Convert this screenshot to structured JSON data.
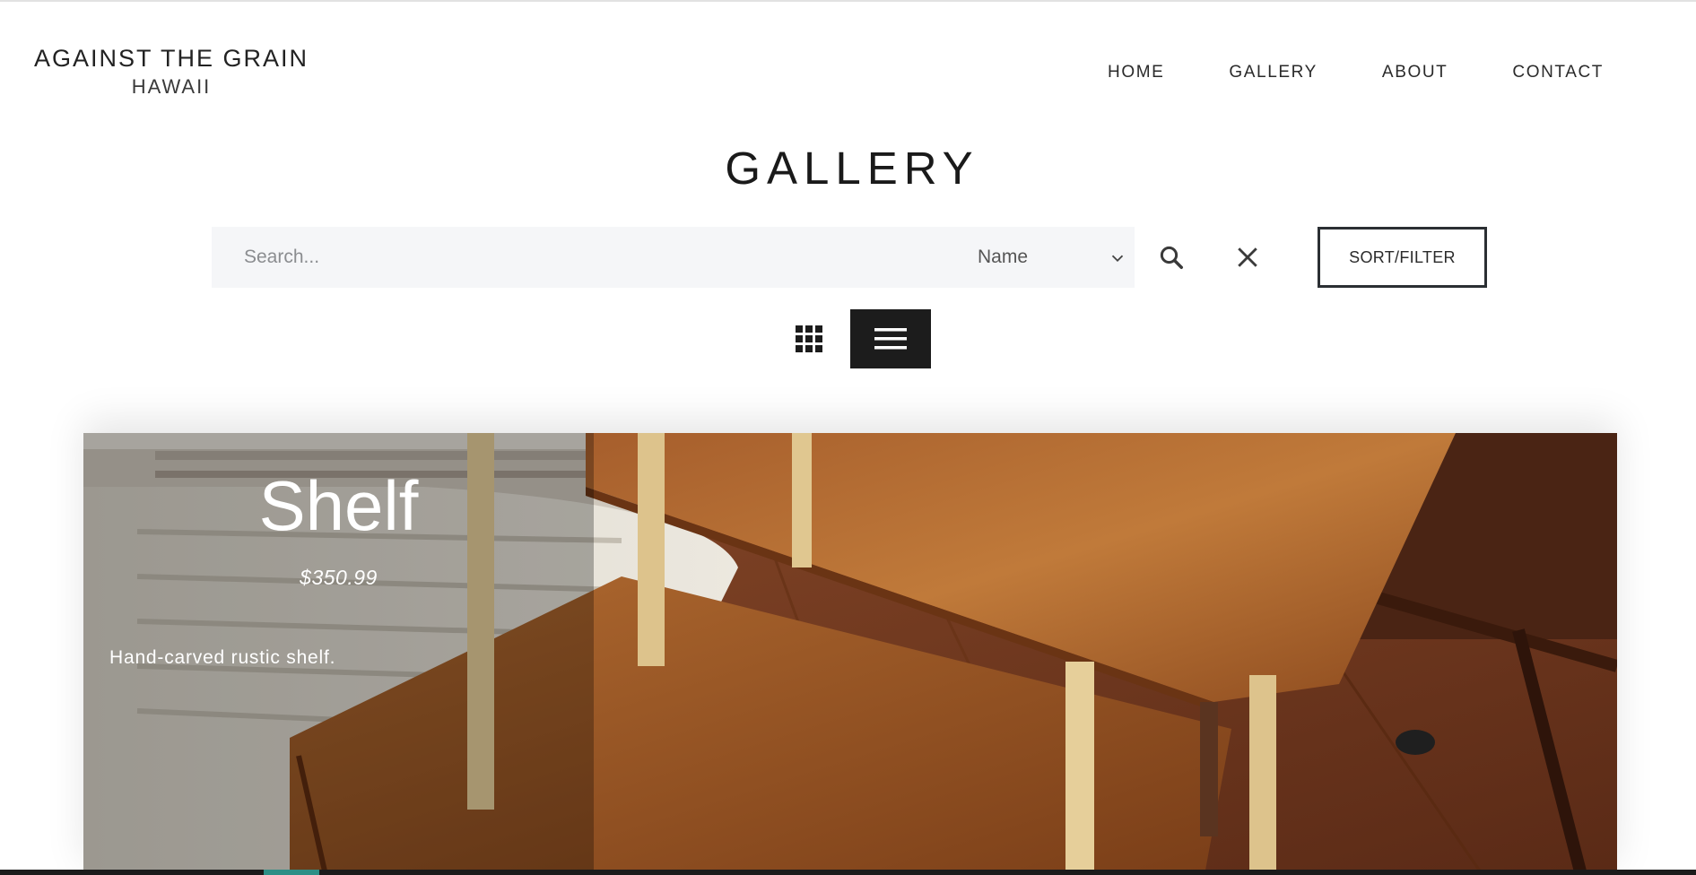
{
  "brand": {
    "line1": "AGAINST THE GRAIN",
    "line2": "HAWAII"
  },
  "nav": {
    "items": [
      {
        "label": "HOME"
      },
      {
        "label": "GALLERY"
      },
      {
        "label": "ABOUT"
      },
      {
        "label": "CONTACT"
      }
    ]
  },
  "page": {
    "title": "GALLERY"
  },
  "search": {
    "placeholder": "Search...",
    "value": "",
    "field_select": {
      "selected": "Name"
    },
    "search_icon": "search-icon",
    "clear_icon": "close-icon"
  },
  "sort_filter": {
    "label": "SORT/FILTER"
  },
  "view_toggle": {
    "options": [
      {
        "name": "grid",
        "icon": "grid-icon",
        "active": false
      },
      {
        "name": "list",
        "icon": "list-icon",
        "active": true
      }
    ]
  },
  "product": {
    "title": "Shelf",
    "price": "$350.99",
    "description": "Hand-carved rustic shelf.",
    "image": "rustic wooden shelf photo"
  },
  "colors": {
    "text": "#1b1b1b",
    "search_bg": "#f5f6f8",
    "active_toggle_bg": "#1c1c1c",
    "sort_border": "#2b2f33",
    "accent": "#2d8f86"
  }
}
